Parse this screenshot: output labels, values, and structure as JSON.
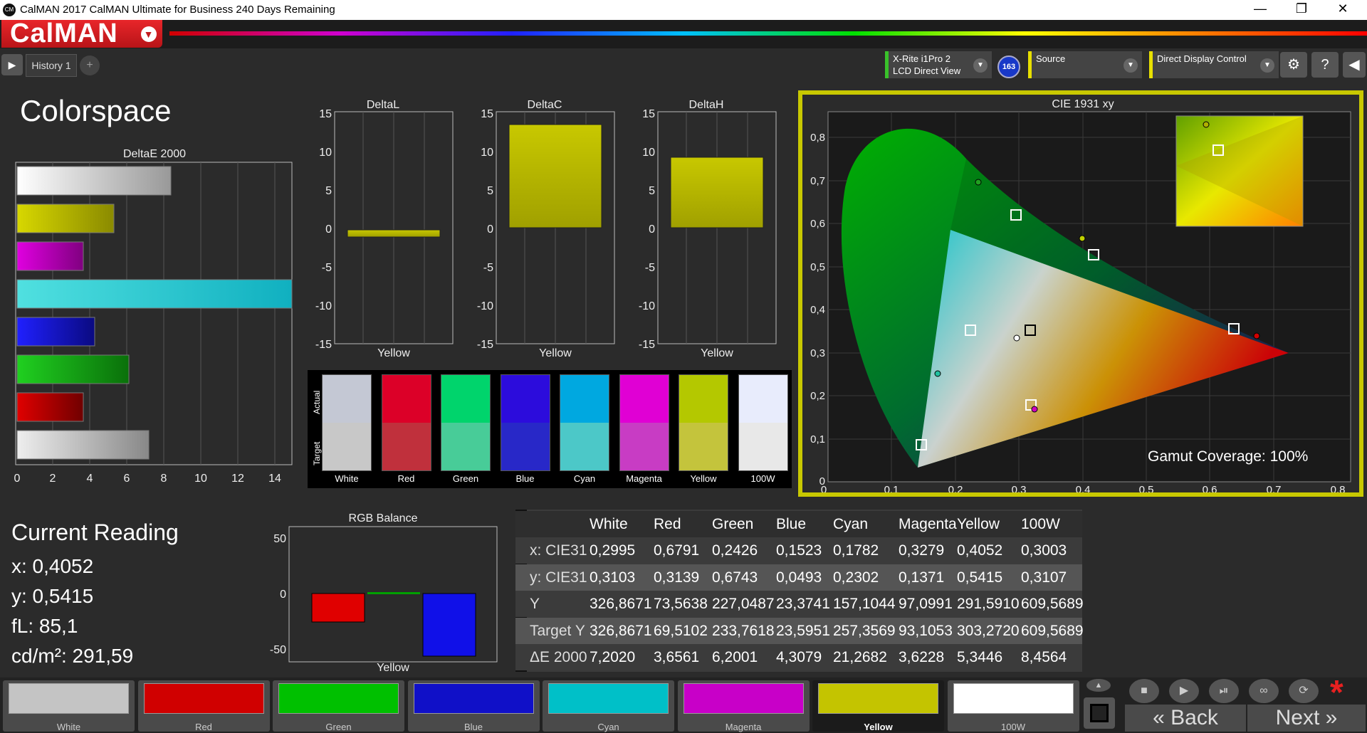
{
  "window": {
    "title": "CalMAN 2017 CalMAN Ultimate for Business 240 Days Remaining",
    "app_icon": "CM",
    "minimize": "—",
    "restore": "❐",
    "close": "✕"
  },
  "logo": {
    "text": "CalMAN"
  },
  "tabs": {
    "history": "History 1",
    "add": "+"
  },
  "devices": {
    "meter_line1": "X-Rite i1Pro 2",
    "meter_line2": "LCD Direct View",
    "meter_badge": "163",
    "source": "Source",
    "display": "Direct Display Control"
  },
  "page": {
    "title": "Colorspace"
  },
  "deltae_chart": {
    "title": "DeltaE 2000",
    "ticks": [
      "0",
      "2",
      "4",
      "6",
      "8",
      "10",
      "12",
      "14"
    ]
  },
  "delta_charts": [
    {
      "title": "DeltaL",
      "xlabel": "Yellow"
    },
    {
      "title": "DeltaC",
      "xlabel": "Yellow"
    },
    {
      "title": "DeltaH",
      "xlabel": "Yellow"
    }
  ],
  "delta_ticks": [
    "15",
    "10",
    "5",
    "0",
    "-5",
    "-10",
    "-15"
  ],
  "swatch_axis": {
    "actual": "Actual",
    "target": "Target"
  },
  "swatches": [
    {
      "label": "White",
      "actual": "#c4c8d4",
      "target": "#c8c8c8"
    },
    {
      "label": "Red",
      "actual": "#dc0028",
      "target": "#c0303c"
    },
    {
      "label": "Green",
      "actual": "#00d46c",
      "target": "#48cc98"
    },
    {
      "label": "Blue",
      "actual": "#2c0cdc",
      "target": "#2828c8"
    },
    {
      "label": "Cyan",
      "actual": "#00a8e0",
      "target": "#4cc8c8"
    },
    {
      "label": "Magenta",
      "actual": "#e000d4",
      "target": "#c83cc4"
    },
    {
      "label": "Yellow",
      "actual": "#b4c800",
      "target": "#c4c43c"
    },
    {
      "label": "100W",
      "actual": "#e8ecfc",
      "target": "#e8e8e8"
    }
  ],
  "cie": {
    "title": "CIE 1931 xy",
    "gamut_label": "Gamut Coverage:",
    "gamut_value": "100%",
    "x_ticks": [
      "0",
      "0,1",
      "0,2",
      "0,3",
      "0,4",
      "0,5",
      "0,6",
      "0,7",
      "0,8"
    ],
    "y_ticks": [
      "0",
      "0,1",
      "0,2",
      "0,3",
      "0,4",
      "0,5",
      "0,6",
      "0,7",
      "0,8"
    ]
  },
  "current_reading": {
    "title": "Current Reading",
    "x": "x: 0,4052",
    "y": "y: 0,5415",
    "fl": "fL: 85,1",
    "cdm2": "cd/m²: 291,59"
  },
  "rgb_balance": {
    "title": "RGB Balance",
    "xlabel": "Yellow",
    "ticks": [
      "50",
      "0",
      "-50"
    ]
  },
  "table": {
    "headers": [
      "",
      "White",
      "Red",
      "Green",
      "Blue",
      "Cyan",
      "Magenta",
      "Yellow",
      "100W"
    ],
    "rows": [
      [
        "x: CIE31",
        "0,2995",
        "0,6791",
        "0,2426",
        "0,1523",
        "0,1782",
        "0,3279",
        "0,4052",
        "0,3003"
      ],
      [
        "y: CIE31",
        "0,3103",
        "0,3139",
        "0,6743",
        "0,0493",
        "0,2302",
        "0,1371",
        "0,5415",
        "0,3107"
      ],
      [
        "Y",
        "326,8671",
        "73,5638",
        "227,0487",
        "23,3741",
        "157,1044",
        "97,0991",
        "291,5910",
        "609,5689"
      ],
      [
        "Target Y",
        "326,8671",
        "69,5102",
        "233,7618",
        "23,5951",
        "257,3569",
        "93,1053",
        "303,2720",
        "609,5689"
      ],
      [
        "ΔE 2000",
        "7,2020",
        "3,6561",
        "6,2001",
        "4,3079",
        "21,2682",
        "3,6228",
        "5,3446",
        "8,4564"
      ]
    ]
  },
  "bottom_buttons": [
    {
      "label": "White",
      "color": "#c4c4c4"
    },
    {
      "label": "Red",
      "color": "#d00000"
    },
    {
      "label": "Green",
      "color": "#00c000"
    },
    {
      "label": "Blue",
      "color": "#1010c8"
    },
    {
      "label": "Cyan",
      "color": "#00c0c8"
    },
    {
      "label": "Magenta",
      "color": "#c800c8"
    },
    {
      "label": "Yellow",
      "color": "#c4c400"
    },
    {
      "label": "100W",
      "color": "#ffffff"
    }
  ],
  "nav": {
    "back": "Back",
    "next": "Next"
  }
}
